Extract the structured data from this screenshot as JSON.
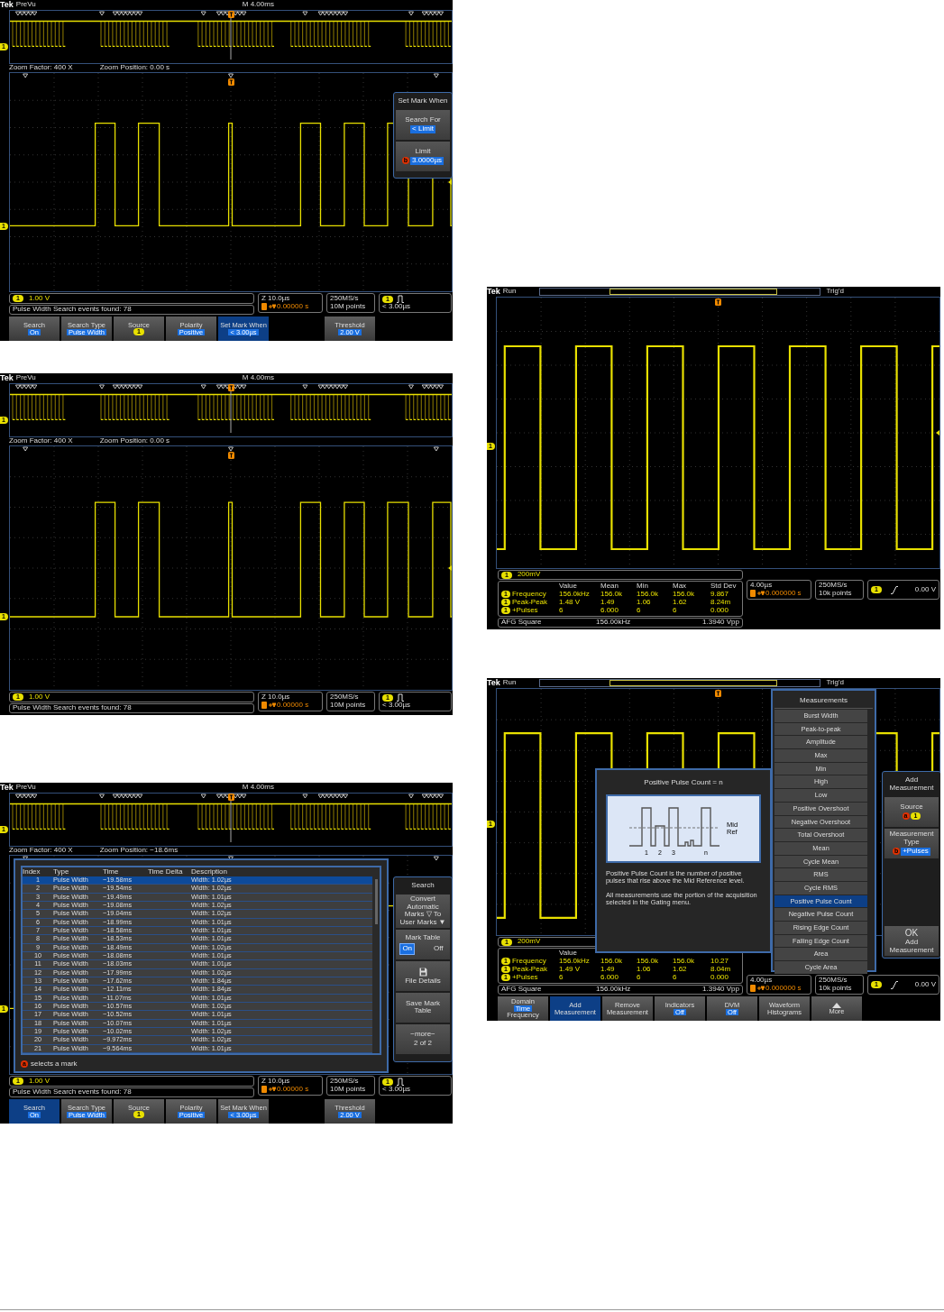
{
  "left_column": [
    {
      "kind": "search",
      "top_bar": {
        "logo": "Tek",
        "state": "PreVu",
        "record": "M 4.00ms"
      },
      "overview": {
        "marker": "1"
      },
      "zoom_info": {
        "factor": "Zoom Factor: 400 X",
        "position": "Zoom Position: 0.00 s"
      },
      "plot": {
        "marker": "1"
      },
      "side_menu": {
        "title": "Set Mark When",
        "items": [
          {
            "kind": "value",
            "label": "Search For",
            "value": "< Limit"
          },
          {
            "kind": "value",
            "label": "Limit",
            "knob": "b",
            "value": "3.0000µs"
          }
        ]
      },
      "channel_readout": {
        "badge": "1",
        "scale": "1.00 V"
      },
      "message": "Pulse Width Search events found: 78",
      "timebase": {
        "scale": "Z 10.0µs",
        "position": "0.00000 s"
      },
      "acquisition": {
        "rate": "250MS/s",
        "points": "10M points"
      },
      "trigger": {
        "badge": "1",
        "kind": "pulse",
        "value": "< 3.00µs"
      },
      "buttons": [
        {
          "kind": "value",
          "label": "Search",
          "value": "On",
          "selected": false
        },
        {
          "kind": "value",
          "label": "Search Type",
          "value": "Pulse Width",
          "selected": false
        },
        {
          "kind": "badge",
          "label": "Source",
          "value": "1",
          "selected": false
        },
        {
          "kind": "value",
          "label": "Polarity",
          "value": "Positive",
          "selected": false
        },
        {
          "kind": "value",
          "label": "Set Mark When",
          "value": "< 3.00µs",
          "selected": true
        },
        {
          "kind": "value",
          "label": "Threshold",
          "value": "2.00 V",
          "selected": false
        }
      ]
    },
    {
      "kind": "search",
      "top_bar": {
        "logo": "Tek",
        "state": "PreVu",
        "record": "M 4.00ms"
      },
      "overview": {
        "marker": "1"
      },
      "zoom_info": {
        "factor": "Zoom Factor: 400 X",
        "position": "Zoom Position: 0.00 s"
      },
      "plot": {
        "marker": "1"
      },
      "channel_readout": {
        "badge": "1",
        "scale": "1.00 V"
      },
      "message": "Pulse Width Search events found: 78",
      "timebase": {
        "scale": "Z 10.0µs",
        "position": "0.00000 s"
      },
      "acquisition": {
        "rate": "250MS/s",
        "points": "10M points"
      },
      "trigger": {
        "badge": "1",
        "kind": "pulse",
        "value": "< 3.00µs"
      }
    },
    {
      "kind": "search",
      "top_bar": {
        "logo": "Tek",
        "state": "PreVu",
        "record": "M 4.00ms"
      },
      "overview": {
        "marker": "1"
      },
      "zoom_info": {
        "factor": "Zoom Factor: 400 X",
        "position": "Zoom Position: −18.6ms"
      },
      "plot": {
        "marker": "1"
      },
      "mark_table": {
        "columns": [
          "Index",
          "Type",
          "Time",
          "Time Delta",
          "Description"
        ],
        "rows": [
          {
            "index": "1",
            "type": "Pulse Width",
            "time": "−19.58ms",
            "description": "Width: 1.02µs",
            "selected": true
          },
          {
            "index": "2",
            "type": "Pulse Width",
            "time": "−19.54ms",
            "description": "Width: 1.02µs",
            "selected": false
          },
          {
            "index": "3",
            "type": "Pulse Width",
            "time": "−19.49ms",
            "description": "Width: 1.01µs",
            "selected": false
          },
          {
            "index": "4",
            "type": "Pulse Width",
            "time": "−19.08ms",
            "description": "Width: 1.02µs",
            "selected": false
          },
          {
            "index": "5",
            "type": "Pulse Width",
            "time": "−19.04ms",
            "description": "Width: 1.02µs",
            "selected": false
          },
          {
            "index": "6",
            "type": "Pulse Width",
            "time": "−18.99ms",
            "description": "Width: 1.01µs",
            "selected": false
          },
          {
            "index": "7",
            "type": "Pulse Width",
            "time": "−18.58ms",
            "description": "Width: 1.01µs",
            "selected": false
          },
          {
            "index": "8",
            "type": "Pulse Width",
            "time": "−18.53ms",
            "description": "Width: 1.01µs",
            "selected": false
          },
          {
            "index": "9",
            "type": "Pulse Width",
            "time": "−18.49ms",
            "description": "Width: 1.02µs",
            "selected": false
          },
          {
            "index": "10",
            "type": "Pulse Width",
            "time": "−18.08ms",
            "description": "Width: 1.01µs",
            "selected": false
          },
          {
            "index": "11",
            "type": "Pulse Width",
            "time": "−18.03ms",
            "description": "Width: 1.01µs",
            "selected": false
          },
          {
            "index": "12",
            "type": "Pulse Width",
            "time": "−17.99ms",
            "description": "Width: 1.02µs",
            "selected": false
          },
          {
            "index": "13",
            "type": "Pulse Width",
            "time": "−17.62ms",
            "description": "Width: 1.84µs",
            "selected": false
          },
          {
            "index": "14",
            "type": "Pulse Width",
            "time": "−12.11ms",
            "description": "Width: 1.84µs",
            "selected": false
          },
          {
            "index": "15",
            "type": "Pulse Width",
            "time": "−11.07ms",
            "description": "Width: 1.01µs",
            "selected": false
          },
          {
            "index": "16",
            "type": "Pulse Width",
            "time": "−10.57ms",
            "description": "Width: 1.02µs",
            "selected": false
          },
          {
            "index": "17",
            "type": "Pulse Width",
            "time": "−10.52ms",
            "description": "Width: 1.01µs",
            "selected": false
          },
          {
            "index": "18",
            "type": "Pulse Width",
            "time": "−10.07ms",
            "description": "Width: 1.01µs",
            "selected": false
          },
          {
            "index": "19",
            "type": "Pulse Width",
            "time": "−10.02ms",
            "description": "Width: 1.02µs",
            "selected": false
          },
          {
            "index": "20",
            "type": "Pulse Width",
            "time": "−9.972ms",
            "description": "Width: 1.02µs",
            "selected": false
          },
          {
            "index": "21",
            "type": "Pulse Width",
            "time": "−9.564ms",
            "description": "Width: 1.01µs",
            "selected": false
          }
        ],
        "hint": {
          "knob": "a",
          "text": "selects a mark"
        }
      },
      "side_menu": {
        "title": "Search",
        "items": [
          {
            "kind": "plain",
            "label": "Convert Automatic Marks ▽ To User Marks ▼"
          },
          {
            "kind": "toggle",
            "label": "Mark Table",
            "options": [
              {
                "label": "On",
                "selected": true
              },
              {
                "label": "Off",
                "selected": false
              }
            ]
          },
          {
            "kind": "icon",
            "label": "File Details"
          },
          {
            "kind": "plain",
            "label": "Save Mark Table"
          },
          {
            "kind": "more",
            "label": "−more−",
            "sub": "2 of 2"
          }
        ]
      },
      "channel_readout": {
        "badge": "1",
        "scale": "1.00 V"
      },
      "message": "Pulse Width Search events found: 78",
      "timebase": {
        "scale": "Z 10.0µs",
        "position": "0.00000 s"
      },
      "acquisition": {
        "rate": "250MS/s",
        "points": "10M points"
      },
      "trigger": {
        "badge": "1",
        "kind": "pulse",
        "value": "< 3.00µs"
      },
      "buttons": [
        {
          "kind": "value",
          "label": "Search",
          "value": "On",
          "selected": true
        },
        {
          "kind": "value",
          "label": "Search Type",
          "value": "Pulse Width",
          "selected": false
        },
        {
          "kind": "badge",
          "label": "Source",
          "value": "1",
          "selected": false
        },
        {
          "kind": "value",
          "label": "Polarity",
          "value": "Positive",
          "selected": false
        },
        {
          "kind": "value",
          "label": "Set Mark When",
          "value": "< 3.00µs",
          "selected": false
        },
        {
          "kind": "value",
          "label": "Threshold",
          "value": "2.00 V",
          "selected": false
        }
      ]
    }
  ],
  "right_column": [
    {
      "kind": "measure",
      "top_bar": {
        "logo": "Tek",
        "state": "Run",
        "trigger_status": "Trig'd"
      },
      "plot": {
        "marker": "1"
      },
      "channel_readout": {
        "badge": "1",
        "scale": "200mV"
      },
      "measurements": {
        "columns": [
          "Value",
          "Mean",
          "Min",
          "Max",
          "Std Dev"
        ],
        "rows": [
          {
            "badge": "1",
            "name": "Frequency",
            "values": [
              "156.0kHz",
              "156.0k",
              "156.0k",
              "156.0k",
              "9.867"
            ]
          },
          {
            "badge": "1",
            "name": "Peak-Peak",
            "values": [
              "1.48 V",
              "1.49",
              "1.06",
              "1.62",
              "8.24m"
            ]
          },
          {
            "badge": "1",
            "name": "+Pulses",
            "values": [
              "6",
              "6.000",
              "6",
              "6",
              "0.000"
            ]
          }
        ]
      },
      "afg": {
        "label": "AFG  Square",
        "frequency": "156.00kHz",
        "amplitude": "1.3940 Vpp"
      },
      "timebase": {
        "scale": "4.00µs",
        "position": "0.000000 s"
      },
      "acquisition": {
        "rate": "250MS/s",
        "points": "10k points"
      },
      "trigger": {
        "badge": "1",
        "kind": "edge",
        "value": "0.00 V"
      }
    },
    {
      "kind": "measure",
      "top_bar": {
        "logo": "Tek",
        "state": "Run",
        "trigger_status": "Trig'd"
      },
      "plot": {
        "marker": "1"
      },
      "info_popup": {
        "title": "Positive Pulse Count = n",
        "ref_label": "Mid Ref",
        "pulse_labels": [
          "1",
          "2",
          "3",
          "n"
        ],
        "description": [
          "Positive Pulse Count is the number of positive pulses that rise above the Mid Reference level.",
          "All measurements use the portion of the acquisition selected in the Gating menu."
        ]
      },
      "measurement_list": {
        "title": "Measurements",
        "items": [
          {
            "label": "Burst Width",
            "selected": false
          },
          {
            "label": "Peak-to-peak",
            "selected": false
          },
          {
            "label": "Amplitude",
            "selected": false
          },
          {
            "label": "Max",
            "selected": false
          },
          {
            "label": "Min",
            "selected": false
          },
          {
            "label": "High",
            "selected": false
          },
          {
            "label": "Low",
            "selected": false
          },
          {
            "label": "Positive Overshoot",
            "selected": false
          },
          {
            "label": "Negative Overshoot",
            "selected": false
          },
          {
            "label": "Total Overshoot",
            "selected": false
          },
          {
            "label": "Mean",
            "selected": false
          },
          {
            "label": "Cycle Mean",
            "selected": false
          },
          {
            "label": "RMS",
            "selected": false
          },
          {
            "label": "Cycle RMS",
            "selected": false
          },
          {
            "label": "Positive Pulse Count",
            "selected": true
          },
          {
            "label": "Negative Pulse Count",
            "selected": false
          },
          {
            "label": "Rising Edge Count",
            "selected": false
          },
          {
            "label": "Falling Edge Count",
            "selected": false
          },
          {
            "label": "Area",
            "selected": false
          },
          {
            "label": "Cycle Area",
            "selected": false
          }
        ]
      },
      "side_menu": {
        "title": "Add Measurement",
        "items": [
          {
            "kind": "badge",
            "label": "Source",
            "knob": "a",
            "value": "1"
          },
          {
            "kind": "value",
            "label": "Measurement Type",
            "knob": "b",
            "value": "+Pulses"
          },
          {
            "kind": "ok",
            "label": "OK",
            "sub": "Add Measurement"
          }
        ]
      },
      "channel_readout": {
        "badge": "1",
        "scale": "200mV"
      },
      "measurements": {
        "columns": [
          "Value"
        ],
        "rows": [
          {
            "badge": "1",
            "name": "Frequency",
            "values": [
              "156.0kHz",
              "156.0k",
              "156.0k",
              "156.0k",
              "10.27"
            ]
          },
          {
            "badge": "1",
            "name": "Peak-Peak",
            "values": [
              "1.49 V",
              "1.49",
              "1.06",
              "1.62",
              "8.04m"
            ]
          },
          {
            "badge": "1",
            "name": "+Pulses",
            "values": [
              "6",
              "6.000",
              "6",
              "6",
              "0.000"
            ]
          }
        ]
      },
      "afg": {
        "label": "AFG  Square",
        "frequency": "156.00kHz",
        "amplitude": "1.3940 Vpp"
      },
      "timebase": {
        "scale": "4.00µs",
        "position": "0.000000 s"
      },
      "acquisition": {
        "rate": "250MS/s",
        "points": "10k points"
      },
      "trigger": {
        "badge": "1",
        "kind": "edge",
        "value": "0.00 V"
      },
      "buttons": [
        {
          "kind": "choice",
          "label": "Domain",
          "value": "Time",
          "sub": "Frequency",
          "selected": false
        },
        {
          "kind": "plain",
          "label": "Add Measurement",
          "selected": true
        },
        {
          "kind": "plain",
          "label": "Remove Measurement",
          "selected": false
        },
        {
          "kind": "value",
          "label": "Indicators",
          "value": "Off",
          "selected": false
        },
        {
          "kind": "value",
          "label": "DVM",
          "value": "Off",
          "selected": false
        },
        {
          "kind": "plain",
          "label": "Waveform Histograms",
          "selected": false
        },
        {
          "kind": "more",
          "label": "More",
          "selected": false
        }
      ]
    }
  ]
}
